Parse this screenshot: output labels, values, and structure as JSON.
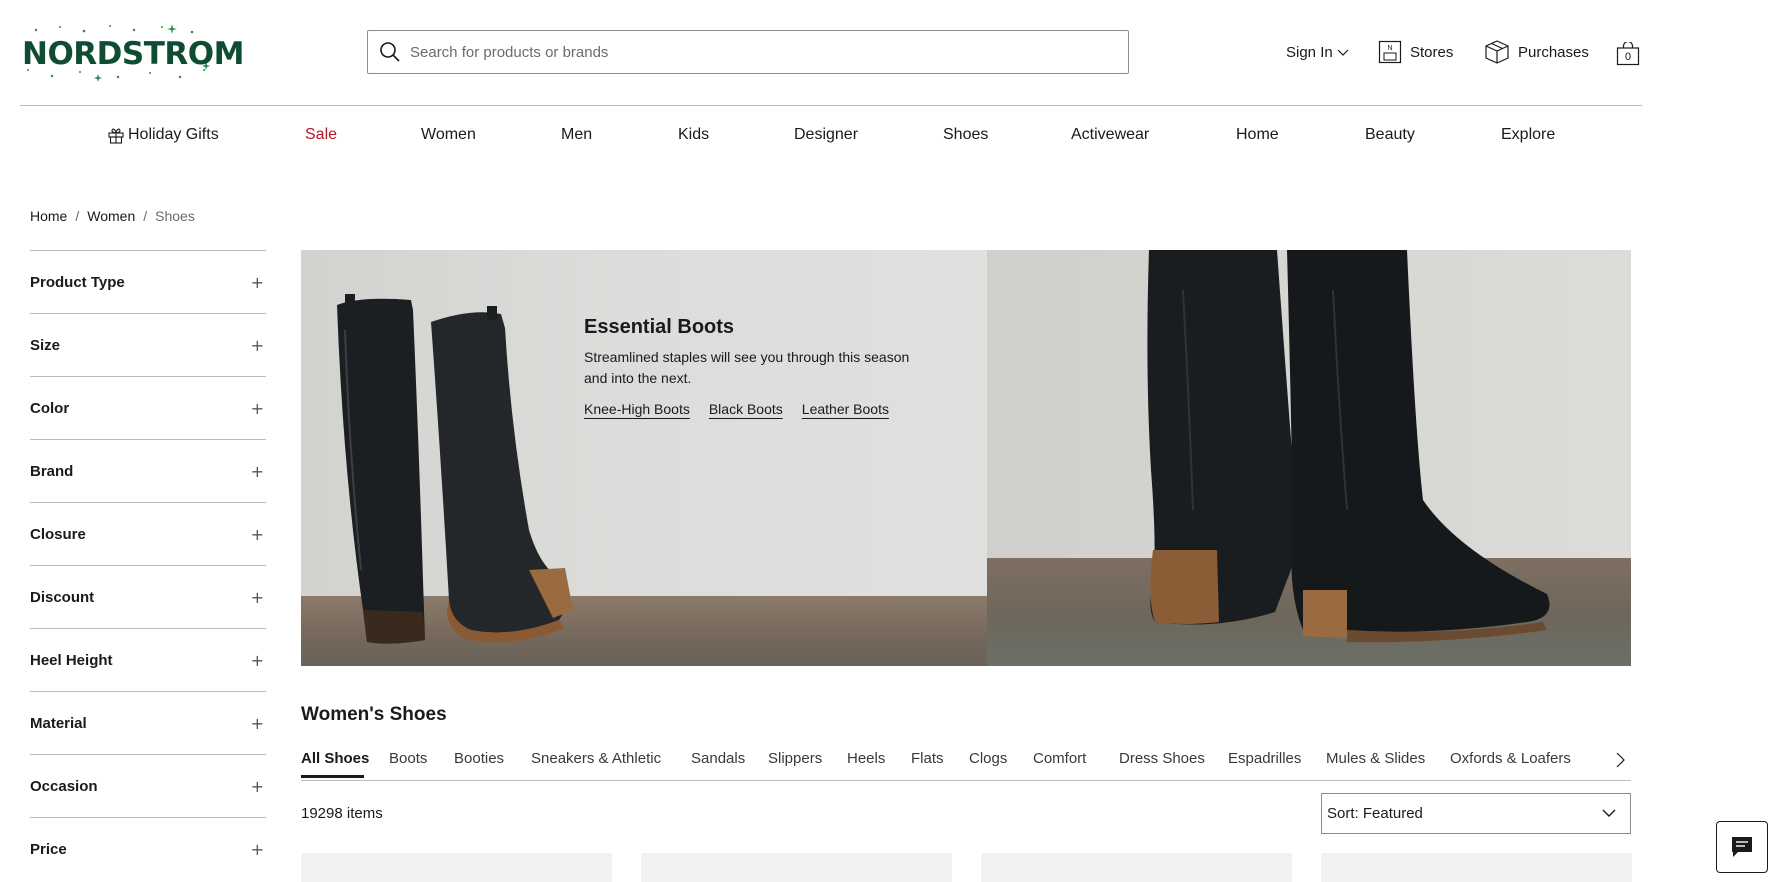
{
  "brand": {
    "name": "NORDSTROM",
    "logo_color": "#0f4d33"
  },
  "search": {
    "placeholder": "Search for products or brands"
  },
  "utility_nav": {
    "sign_in": "Sign In",
    "stores": "Stores",
    "purchases": "Purchases",
    "bag_count": "0"
  },
  "main_nav": {
    "items": [
      {
        "label": "Holiday Gifts",
        "icon": "gift-icon"
      },
      {
        "label": "Sale",
        "color": "#b7162a"
      },
      {
        "label": "Women"
      },
      {
        "label": "Men"
      },
      {
        "label": "Kids"
      },
      {
        "label": "Designer"
      },
      {
        "label": "Shoes"
      },
      {
        "label": "Activewear"
      },
      {
        "label": "Home"
      },
      {
        "label": "Beauty"
      },
      {
        "label": "Explore"
      }
    ]
  },
  "breadcrumb": {
    "items": [
      "Home",
      "Women",
      "Shoes"
    ],
    "separator": "/"
  },
  "filters": {
    "items": [
      "Product Type",
      "Size",
      "Color",
      "Brand",
      "Closure",
      "Discount",
      "Heel Height",
      "Material",
      "Occasion",
      "Price"
    ]
  },
  "hero": {
    "title": "Essential Boots",
    "subtitle": "Streamlined staples will see you through this season and into the next.",
    "links": [
      "Knee-High Boots",
      "Black Boots",
      "Leather Boots"
    ]
  },
  "products": {
    "title": "Women's Shoes",
    "categories": [
      "All Shoes",
      "Boots",
      "Booties",
      "Sneakers & Athletic",
      "Sandals",
      "Slippers",
      "Heels",
      "Flats",
      "Clogs",
      "Comfort",
      "Dress Shoes",
      "Espadrilles",
      "Mules & Slides",
      "Oxfords & Loafers"
    ],
    "active_category": "All Shoes",
    "item_count": "19298 items",
    "sort": "Sort: Featured"
  },
  "icons": {
    "search": "search-icon",
    "stores": "store-icon",
    "purchases": "box-icon",
    "bag": "shopping-bag-icon",
    "chat": "chat-icon"
  }
}
